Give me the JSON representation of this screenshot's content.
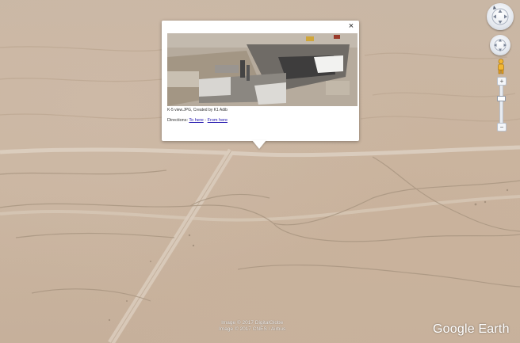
{
  "balloon": {
    "close_glyph": "×",
    "caption": "K-5 view.JPG, Created by K1 Adib",
    "directions_label": "Directions: ",
    "to_here": "To here",
    "separator": " - ",
    "from_here": "From here"
  },
  "nav": {
    "zoom_in": "+",
    "zoom_out": "−"
  },
  "imagery_credit": {
    "line1": "Image © 2017 DigitalGlobe",
    "line2": "Image © 2017 CNES / Airbus"
  },
  "brand": "Google Earth"
}
